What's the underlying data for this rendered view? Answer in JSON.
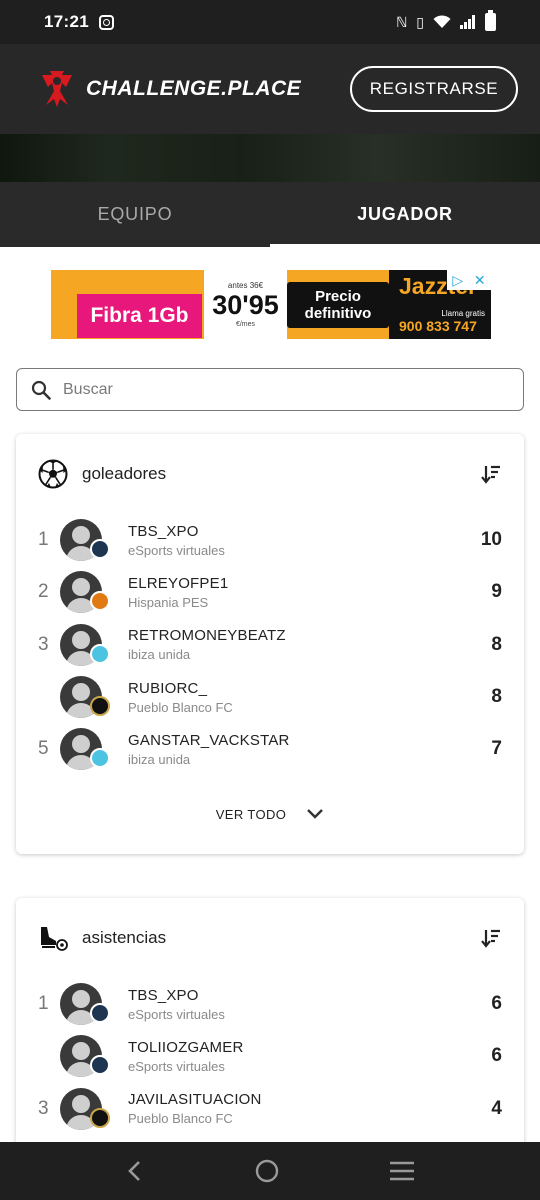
{
  "status_bar": {
    "time": "17:21"
  },
  "header": {
    "brand": "CHALLENGE.PLACE",
    "register_label": "REGISTRARSE"
  },
  "tabs": [
    {
      "label": "EQUIPO",
      "active": false
    },
    {
      "label": "JUGADOR",
      "active": true
    }
  ],
  "ad": {
    "fibra": "Fibra 1Gb",
    "before": "antes 36€",
    "price": "30'95",
    "price_unit": "€/mes",
    "precio": "Precio definitivo",
    "brand": "Jazztel",
    "call": "Llama gratis",
    "phone": "900 833 747"
  },
  "search": {
    "placeholder": "Buscar",
    "value": ""
  },
  "leaderboards": [
    {
      "title": "goleadores",
      "icon": "soccer-ball-icon",
      "rows": [
        {
          "rank": "1",
          "name": "TBS_XPO",
          "team": "eSports virtuales",
          "value": "10",
          "badge": "esports"
        },
        {
          "rank": "2",
          "name": "ELREYOFPE1",
          "team": "Hispania PES",
          "value": "9",
          "badge": "hispania"
        },
        {
          "rank": "3",
          "name": "RETROMONEYBEATZ",
          "team": "ibiza unida",
          "value": "8",
          "badge": "ibiza"
        },
        {
          "rank": "",
          "name": "RUBIORC_",
          "team": "Pueblo Blanco FC",
          "value": "8",
          "badge": "pueblo"
        },
        {
          "rank": "5",
          "name": "GANSTAR_VACKSTAR",
          "team": "ibiza unida",
          "value": "7",
          "badge": "ibiza"
        }
      ],
      "see_all": "VER TODO"
    },
    {
      "title": "asistencias",
      "icon": "boot-ball-icon",
      "rows": [
        {
          "rank": "1",
          "name": "TBS_XPO",
          "team": "eSports virtuales",
          "value": "6",
          "badge": "esports"
        },
        {
          "rank": "",
          "name": "TOLIIOZGAMER",
          "team": "eSports virtuales",
          "value": "6",
          "badge": "esports"
        },
        {
          "rank": "3",
          "name": "JAVILASITUACION",
          "team": "Pueblo Blanco FC",
          "value": "4",
          "badge": "pueblo"
        }
      ]
    }
  ],
  "colors": {
    "header_bg": "#282828",
    "tab_bg": "#2a2a2a",
    "brand_red": "#d71920"
  }
}
